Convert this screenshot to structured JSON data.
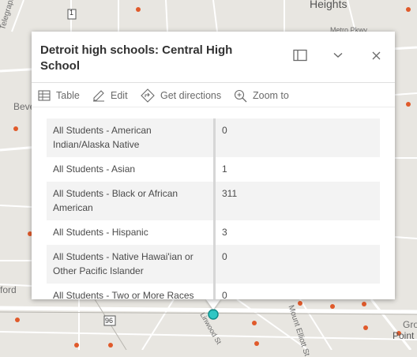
{
  "map": {
    "labels": {
      "heights": "Heights",
      "metro_pkwy": "Metro Pkwy",
      "telegraph": "Telegraph Rd",
      "beve": "Beve",
      "ford": "ford",
      "route1": "1",
      "route96": "96",
      "mount_elliott": "Mount Elliott St",
      "linwood": "Linwood St",
      "gro": "Gro",
      "point": "Point"
    },
    "colors": {
      "background": "#e8e6e1",
      "roads": "#ffffff",
      "marker": "#e05a2b",
      "selected": "#2fc7c4"
    }
  },
  "popup": {
    "title": "Detroit high schools: Central High School",
    "actions": [
      {
        "label": "Table",
        "icon": "table-icon"
      },
      {
        "label": "Edit",
        "icon": "edit-icon"
      },
      {
        "label": "Get directions",
        "icon": "directions-icon"
      },
      {
        "label": "Zoom to",
        "icon": "zoom-to-icon"
      }
    ],
    "rows": [
      {
        "field": "All Students - American Indian/Alaska Native",
        "value": "0"
      },
      {
        "field": "All Students - Asian",
        "value": "1"
      },
      {
        "field": "All Students - Black or African American",
        "value": "311"
      },
      {
        "field": "All Students - Hispanic",
        "value": "3"
      },
      {
        "field": "All Students - Native Hawai'ian or Other Pacific Islander",
        "value": "0"
      },
      {
        "field": "All Students - Two or More Races",
        "value": "0"
      }
    ]
  }
}
